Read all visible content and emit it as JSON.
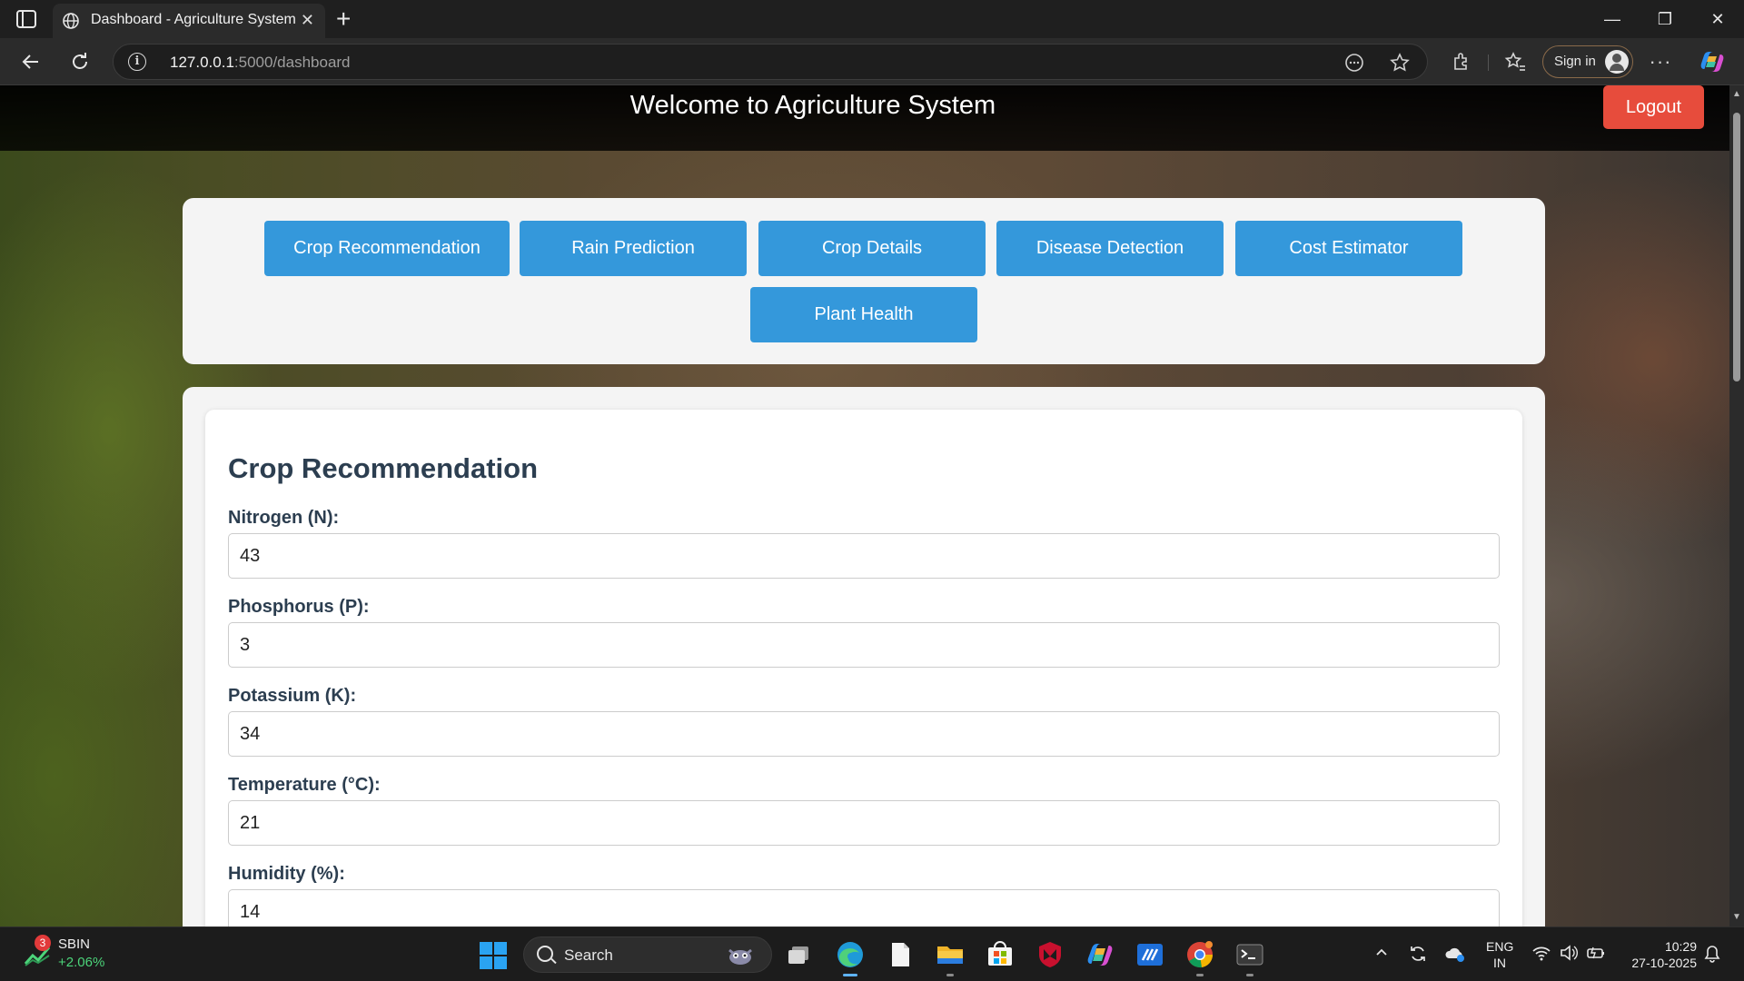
{
  "browser": {
    "tab_title": "Dashboard - Agriculture System",
    "tab_close": "✕",
    "new_tab": "+",
    "url_host": "127.0.0.1",
    "url_path": ":5000/dashboard",
    "sign_in_label": "Sign in",
    "more_label": "···",
    "window_controls": {
      "minimize": "—",
      "restore": "❐",
      "close": "✕"
    }
  },
  "header": {
    "title": "Welcome to Agriculture System",
    "logout_label": "Logout"
  },
  "features": [
    "Crop Recommendation",
    "Rain Prediction",
    "Crop Details",
    "Disease Detection",
    "Cost Estimator",
    "Plant Health"
  ],
  "form": {
    "heading": "Crop Recommendation",
    "fields": [
      {
        "label": "Nitrogen (N):",
        "value": "43"
      },
      {
        "label": "Phosphorus (P):",
        "value": "3"
      },
      {
        "label": "Potassium (K):",
        "value": "34"
      },
      {
        "label": "Temperature (°C):",
        "value": "21"
      },
      {
        "label": "Humidity (%):",
        "value": "14"
      }
    ]
  },
  "taskbar": {
    "stock_badge": "3",
    "stock_name": "SBIN",
    "stock_change": "+2.06%",
    "search_label": "Search",
    "lang_line1": "ENG",
    "lang_line2": "IN",
    "time": "10:29",
    "date": "27-10-2025"
  },
  "colors": {
    "primary_button": "#3498db",
    "logout_button": "#e74c3c",
    "heading_text": "#2c3e50"
  }
}
